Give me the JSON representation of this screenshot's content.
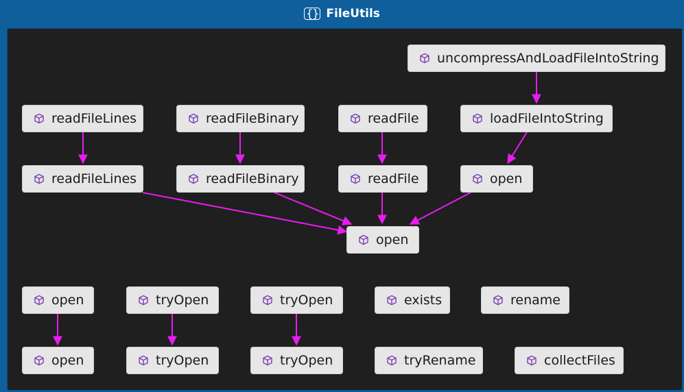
{
  "header": {
    "title": "FileUtils",
    "icon": "namespace-braces-icon"
  },
  "colors": {
    "edge": "#e81cf0",
    "node_fill": "#e6e6e6",
    "background": "#1f1f1f",
    "frame": "#0e5f9c",
    "cube_icon": "#7a3fb0"
  },
  "nodes": {
    "n_uncompress": "uncompressAndLoadFileIntoString",
    "n_readFileLines_top": "readFileLines",
    "n_readFileBinary_top": "readFileBinary",
    "n_readFile_top": "readFile",
    "n_loadFileIntoString": "loadFileIntoString",
    "n_readFileLines_mid": "readFileLines",
    "n_readFileBinary_mid": "readFileBinary",
    "n_readFile_mid": "readFile",
    "n_open_mid": "open",
    "n_open_center": "open",
    "n_open_b1": "open",
    "n_tryOpen_b1": "tryOpen",
    "n_tryOpen_b2": "tryOpen",
    "n_exists": "exists",
    "n_rename": "rename",
    "n_open_b1_bottom": "open",
    "n_tryOpen_b1_bottom": "tryOpen",
    "n_tryOpen_b2_bottom": "tryOpen",
    "n_tryRename": "tryRename",
    "n_collectFiles": "collectFiles"
  }
}
